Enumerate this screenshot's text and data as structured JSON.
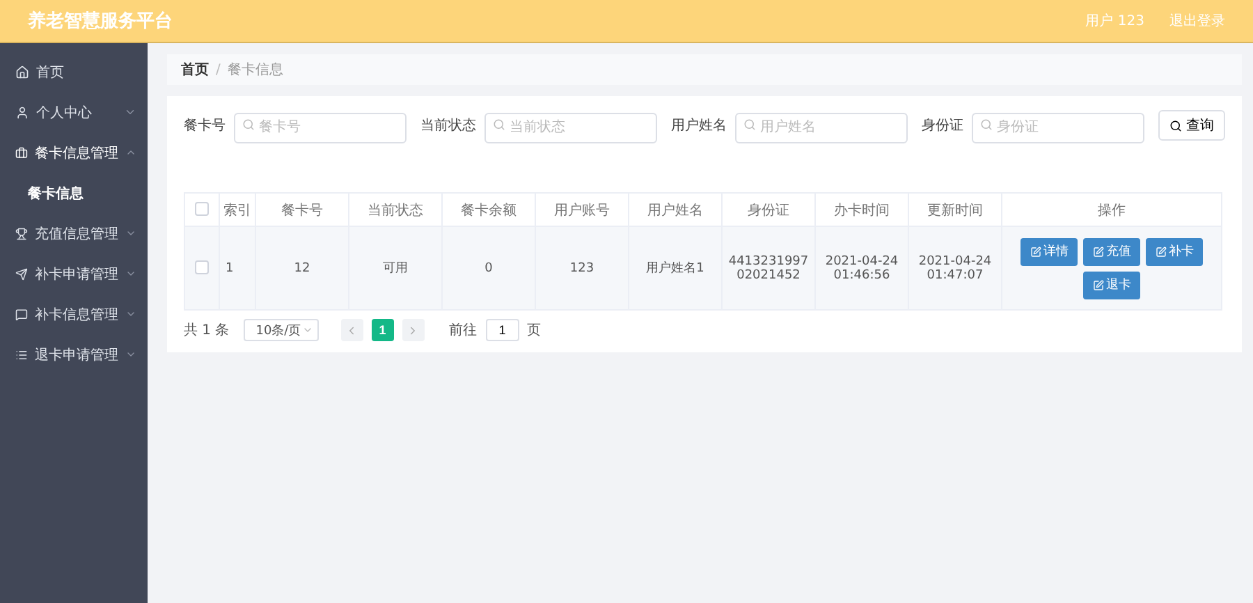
{
  "header": {
    "title": "养老智慧服务平台",
    "user": "用户 123",
    "logout": "退出登录"
  },
  "sidebar": {
    "items": [
      {
        "label": "首页"
      },
      {
        "label": "个人中心",
        "expanded": false
      },
      {
        "label": "餐卡信息管理",
        "expanded": true,
        "children": [
          {
            "label": "餐卡信息",
            "selected": true
          }
        ]
      },
      {
        "label": "充值信息管理",
        "expanded": false
      },
      {
        "label": "补卡申请管理",
        "expanded": false
      },
      {
        "label": "补卡信息管理",
        "expanded": false
      },
      {
        "label": "退卡申请管理",
        "expanded": false
      }
    ]
  },
  "breadcrumb": {
    "items": [
      "首页",
      "餐卡信息"
    ],
    "separator": "/"
  },
  "filters": [
    {
      "label": "餐卡号",
      "placeholder": "餐卡号"
    },
    {
      "label": "当前状态",
      "placeholder": "当前状态"
    },
    {
      "label": "用户姓名",
      "placeholder": "用户姓名"
    },
    {
      "label": "身份证",
      "placeholder": "身份证"
    }
  ],
  "search_button": "查询",
  "table": {
    "all_checked": false,
    "columns": [
      "索引",
      "餐卡号",
      "当前状态",
      "餐卡余额",
      "用户账号",
      "用户姓名",
      "身份证",
      "办卡时间",
      "更新时间",
      "操作"
    ],
    "rows": [
      {
        "checked": false,
        "cells": [
          "1",
          "12",
          "可用",
          "0",
          "123",
          "用户姓名1",
          "441323199702021452",
          "2021-04-24 01:46:56",
          "2021-04-24 01:47:07"
        ],
        "actions": [
          "详情",
          "充值",
          "补卡",
          "退卡"
        ]
      }
    ]
  },
  "pagination": {
    "total": "共 1 条",
    "page_size": "10条/页",
    "pages": [
      {
        "label": "1",
        "selected": true
      }
    ],
    "goto_label": "前往",
    "goto_value": "1",
    "goto_suffix": "页"
  }
}
